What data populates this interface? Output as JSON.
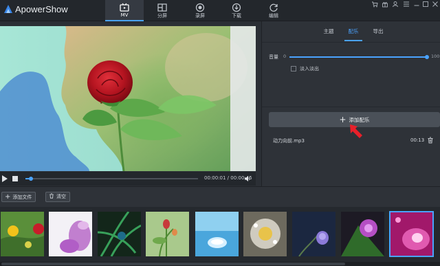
{
  "app": {
    "title": "ApowerShow"
  },
  "nav_tabs": [
    {
      "label": "MV",
      "icon": "mv-icon",
      "active": true
    },
    {
      "label": "分屏",
      "icon": "split-screen-icon",
      "active": false
    },
    {
      "label": "录屏",
      "icon": "record-icon",
      "active": false
    },
    {
      "label": "下载",
      "icon": "download-icon",
      "active": false
    },
    {
      "label": "编辑",
      "icon": "edit-icon",
      "active": false
    }
  ],
  "window_controls": [
    "cart-icon",
    "gift-icon",
    "user-icon",
    "settings-icon",
    "minimize-icon",
    "maximize-icon",
    "close-icon"
  ],
  "player": {
    "time": "00:00:01 / 00:00:45",
    "progress": 0.03
  },
  "right_panel": {
    "tabs": [
      {
        "label": "主题",
        "active": false
      },
      {
        "label": "配乐",
        "active": true
      },
      {
        "label": "导出",
        "active": false
      }
    ],
    "volume_label": "音量",
    "volume_min": "0",
    "volume_max": "100",
    "volume_value": 100,
    "fade_label": "淡入淡出",
    "add_music_label": "添加配乐",
    "track": {
      "name": "动力向前.mp3",
      "duration": "00:13"
    }
  },
  "toolbar": {
    "add_file_label": "添加文件",
    "clear_label": "清空"
  },
  "thumbnails": [
    {
      "subject": "flowers"
    },
    {
      "subject": "purple-orchid"
    },
    {
      "subject": "green-grass"
    },
    {
      "subject": "rose-buds"
    },
    {
      "subject": "water-drop"
    },
    {
      "subject": "frost-flower"
    },
    {
      "subject": "blue-flower"
    },
    {
      "subject": "purple-thistle"
    },
    {
      "subject": "pink-flower",
      "selected": true
    }
  ],
  "colors": {
    "accent": "#4aa3ff",
    "arrow": "#e8202a",
    "background": "#2b2f35"
  }
}
